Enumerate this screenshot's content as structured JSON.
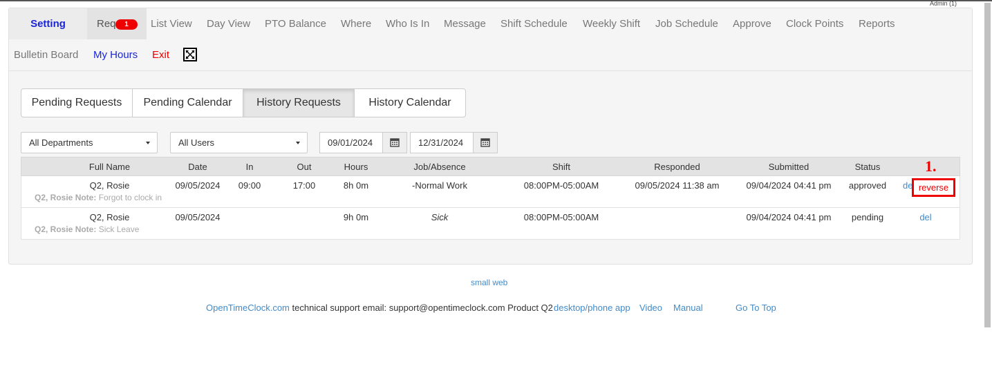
{
  "admin_label": "Admin (1)",
  "nav": {
    "setting": "Setting",
    "req": "Req",
    "req_badge": "1",
    "list_view": "List View",
    "day_view": "Day View",
    "pto_balance": "PTO Balance",
    "where": "Where",
    "who_is_in": "Who Is In",
    "message": "Message",
    "shift_schedule": "Shift Schedule",
    "weekly_shift": "Weekly Shift",
    "job_schedule": "Job Schedule",
    "approve": "Approve",
    "clock_points": "Clock Points",
    "reports": "Reports",
    "bulletin_board": "Bulletin Board",
    "my_hours": "My Hours",
    "exit": "Exit"
  },
  "tabs": {
    "pending_requests": "Pending Requests",
    "pending_calendar": "Pending Calendar",
    "history_requests": "History Requests",
    "history_calendar": "History Calendar"
  },
  "filters": {
    "department": "All Departments",
    "users": "All Users",
    "start_date": "09/01/2024",
    "end_date": "12/31/2024"
  },
  "table": {
    "headers": {
      "full_name": "Full Name",
      "date": "Date",
      "in": "In",
      "out": "Out",
      "hours": "Hours",
      "job": "Job/Absence",
      "shift": "Shift",
      "responded": "Responded",
      "submitted": "Submitted",
      "status": "Status"
    },
    "rows": [
      {
        "name": "Q2, Rosie",
        "date": "09/05/2024",
        "in": "09:00",
        "out": "17:00",
        "hours": "8h 0m",
        "job": "-Normal Work",
        "shift": "08:00PM-05:00AM",
        "responded": "09/05/2024 11:38 am",
        "submitted": "09/04/2024 04:41 pm",
        "status": "approved",
        "del": "de",
        "reverse": "reverse",
        "note_label": "Q2, Rosie Note:",
        "note_text": "Forgot to clock in"
      },
      {
        "name": "Q2, Rosie",
        "date": "09/05/2024",
        "in": "",
        "out": "",
        "hours": "9h 0m",
        "job": "Sick",
        "shift": "08:00PM-05:00AM",
        "responded": "",
        "submitted": "09/04/2024 04:41 pm",
        "status": "pending",
        "del": "del",
        "note_label": "Q2, Rosie Note:",
        "note_text": "Sick Leave"
      }
    ]
  },
  "annotation": "1.",
  "footer": {
    "small_web": "small web",
    "site_link": "OpenTimeClock.com",
    "support_text": "technical support email: support@opentimeclock.com Product Q2",
    "desktop_app": "desktop/phone app",
    "video": "Video",
    "manual": "Manual",
    "go_to_top": "Go To Top"
  }
}
